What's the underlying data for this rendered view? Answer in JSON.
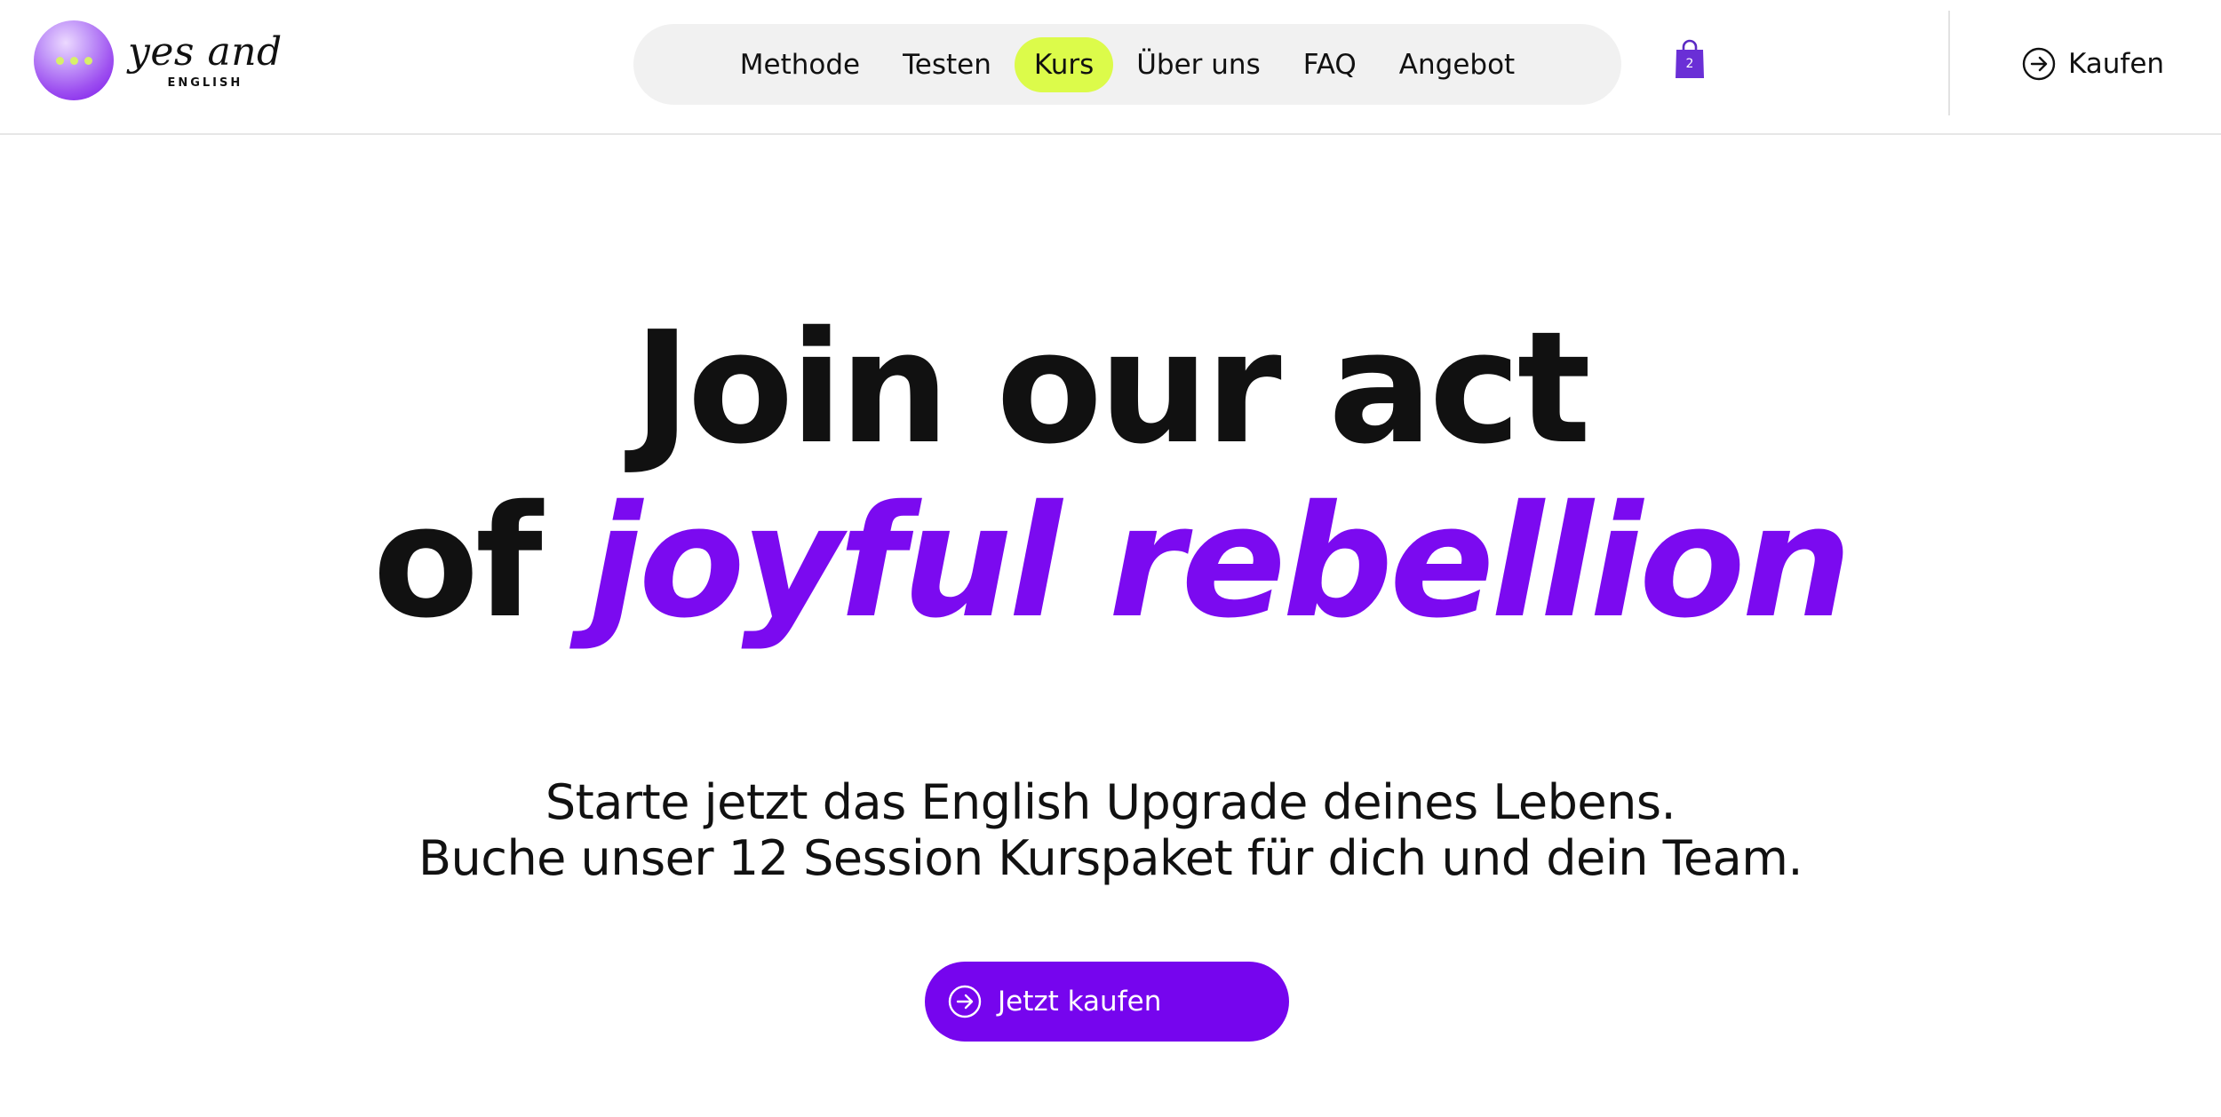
{
  "brand": {
    "name": "yes and",
    "sub": "ENGLISH"
  },
  "nav": {
    "items": [
      {
        "label": "Methode",
        "active": false
      },
      {
        "label": "Testen",
        "active": false
      },
      {
        "label": "Kurs",
        "active": true
      },
      {
        "label": "Über uns",
        "active": false
      },
      {
        "label": "FAQ",
        "active": false
      },
      {
        "label": "Angebot",
        "active": false
      }
    ]
  },
  "cart": {
    "count": "2",
    "icon": "shopping-bag-icon"
  },
  "header": {
    "buy_label": "Kaufen",
    "buy_icon": "arrow-circle-right-icon"
  },
  "hero": {
    "line1": "Join our act",
    "line2_prefix": "of ",
    "line2_accent": "joyful rebellion",
    "subtitle_line1": "Starte jetzt das English Upgrade deines Lebens.",
    "subtitle_line2": "Buche unser 12 Session Kurspaket für dich und dein Team.",
    "cta_label": "Jetzt kaufen",
    "cta_icon": "arrow-circle-right-icon"
  },
  "colors": {
    "accent_purple": "#7605ee",
    "nav_active": "#dcfb4a",
    "nav_background": "#f1f1f1"
  }
}
